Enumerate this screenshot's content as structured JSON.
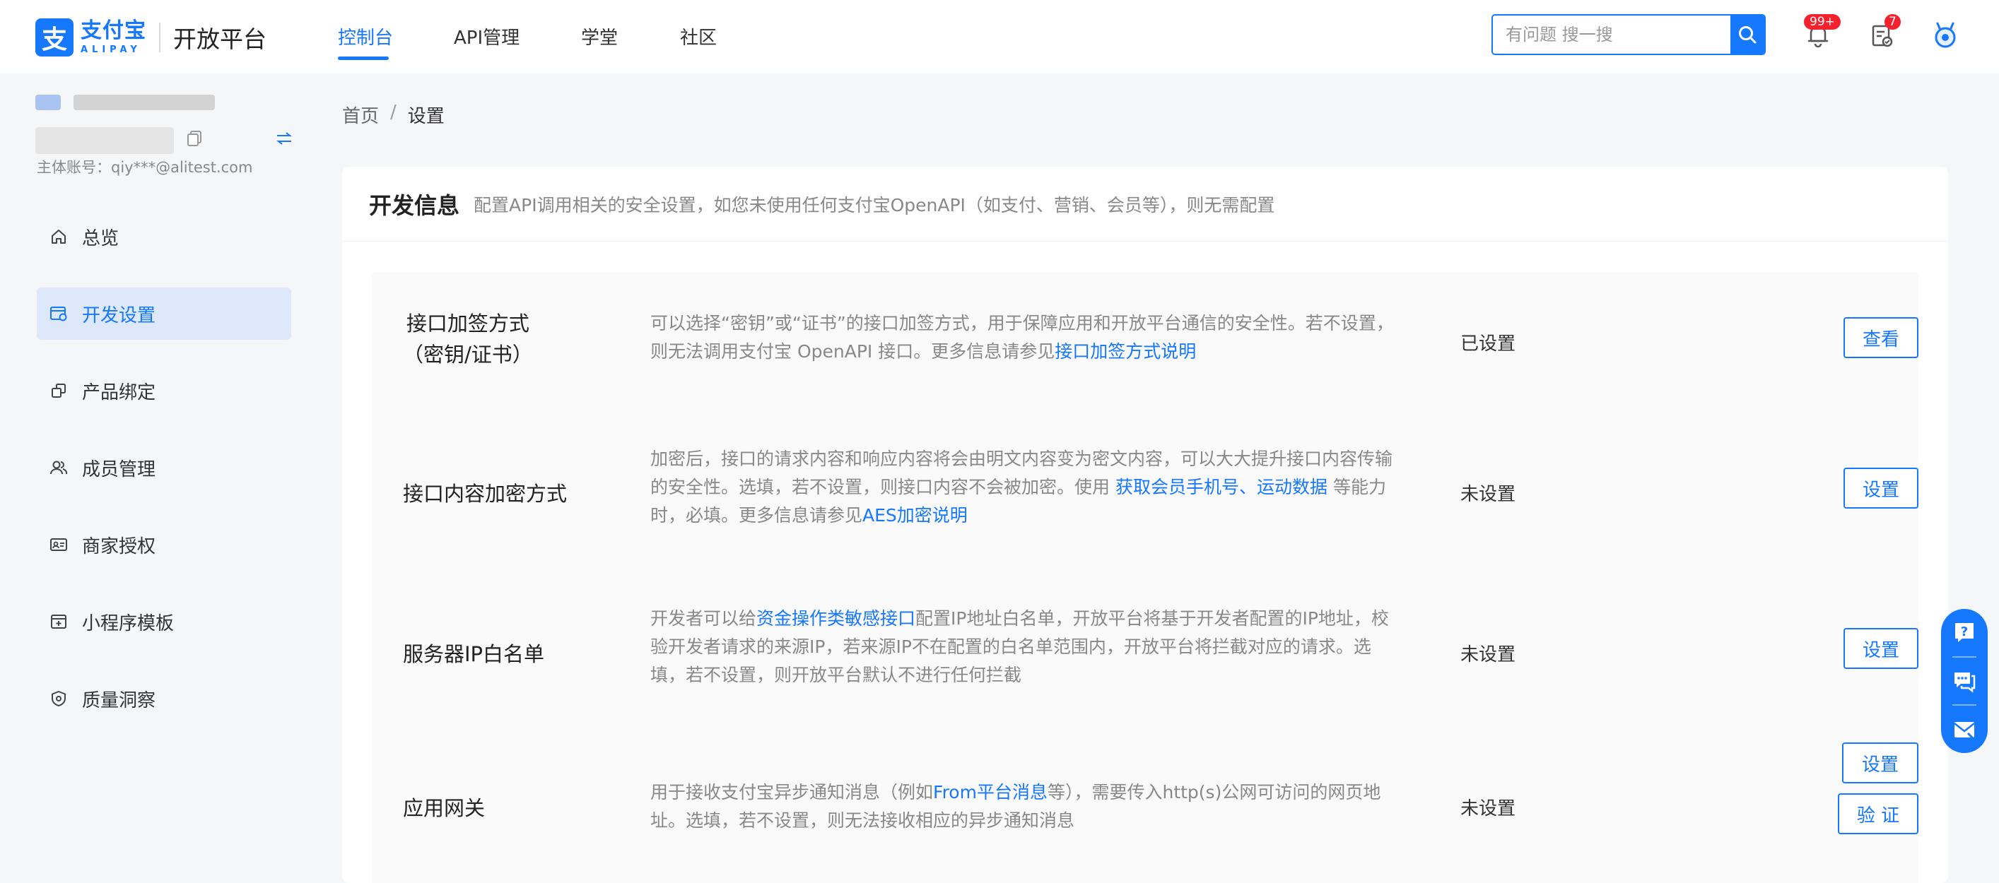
{
  "brand": {
    "logo_cn": "支付宝",
    "logo_en": "ALIPAY",
    "platform": "开放平台",
    "color": "#1677ff"
  },
  "nav": {
    "tabs": [
      {
        "label": "控制台",
        "active": true
      },
      {
        "label": "API管理",
        "active": false
      },
      {
        "label": "学堂",
        "active": false
      },
      {
        "label": "社区",
        "active": false
      }
    ]
  },
  "search": {
    "placeholder": "有问题 搜一搜",
    "icon": "search-icon"
  },
  "header_icons": {
    "notification": {
      "icon": "bell-icon",
      "badge": "99+"
    },
    "tasks": {
      "icon": "todo-icon",
      "badge": "7"
    },
    "avatar": {
      "icon": "avatar-icon"
    }
  },
  "account": {
    "main_account_label": "主体账号：qiy***@alitest.com"
  },
  "sidebar": {
    "items": [
      {
        "label": "总览",
        "icon": "home-icon",
        "active": false
      },
      {
        "label": "开发设置",
        "icon": "dev-settings-icon",
        "active": true
      },
      {
        "label": "产品绑定",
        "icon": "product-bind-icon",
        "active": false
      },
      {
        "label": "成员管理",
        "icon": "members-icon",
        "active": false
      },
      {
        "label": "商家授权",
        "icon": "merchant-auth-icon",
        "active": false
      },
      {
        "label": "小程序模板",
        "icon": "miniapp-template-icon",
        "active": false
      },
      {
        "label": "质量洞察",
        "icon": "quality-shield-icon",
        "active": false
      }
    ]
  },
  "breadcrumb": {
    "home": "首页",
    "separator": "/",
    "current": "设置"
  },
  "dev_info": {
    "title": "开发信息",
    "desc": "配置API调用相关的安全设置，如您未使用任何支付宝OpenAPI（如支付、营销、会员等），则无需配置",
    "rows": [
      {
        "label_line1": "接口加签方式",
        "label_line2": "（密钥/证书）",
        "desc_text1": "可以选择“密钥”或“证书”的接口加签方式，用于保障应用和开放平台通信的安全性。若不设置，则无法调用支付宝 OpenAPI 接口。更多信息请参见",
        "desc_link1": "接口加签方式说明",
        "status": "已设置",
        "button": "查看"
      },
      {
        "label": "接口内容加密方式",
        "desc_text1": "加密后，接口的请求内容和响应内容将会由明文内容变为密文内容，可以大大提升接口内容传输的安全性。选填，若不设置，则接口内容不会被加密。使用 ",
        "desc_link1": "获取会员手机号",
        "desc_sep": "、",
        "desc_link2": "运动数据",
        "desc_text2": " 等能力时，必填。更多信息请参见",
        "desc_link3": "AES加密说明",
        "status": "未设置",
        "button": "设置"
      },
      {
        "label": "服务器IP白名单",
        "desc_text1": "开发者可以给",
        "desc_link1": "资金操作类敏感接口",
        "desc_text2": "配置IP地址白名单，开放平台将基于开发者配置的IP地址，校验开发者请求的来源IP，若来源IP不在配置的白名单范围内，开放平台将拦截对应的请求。选填，若不设置，则开放平台默认不进行任何拦截",
        "status": "未设置",
        "button": "设置"
      },
      {
        "label": "应用网关",
        "desc_text1": "用于接收支付宝异步通知消息（例如",
        "desc_link1": "From平台消息",
        "desc_text2": "等），需要传入http(s)公网可访问的网页地址。选填，若不设置，则无法接收相应的异步通知消息",
        "status": "未设置",
        "button": "设置",
        "button2": "验 证"
      }
    ]
  },
  "float_help": {
    "icons": [
      "question-icon",
      "chat-icon",
      "feedback-mail-icon"
    ]
  }
}
